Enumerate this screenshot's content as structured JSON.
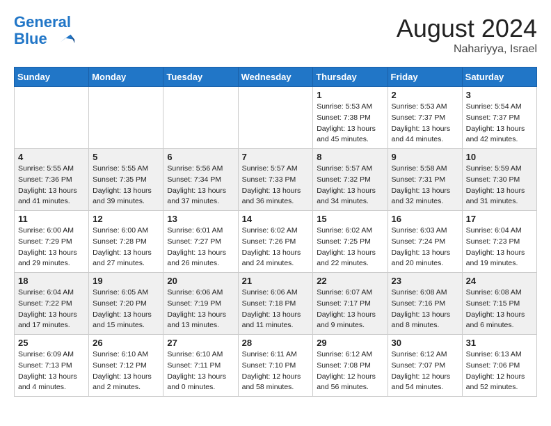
{
  "header": {
    "logo_line1": "General",
    "logo_line2": "Blue",
    "month": "August 2024",
    "location": "Nahariyya, Israel"
  },
  "weekdays": [
    "Sunday",
    "Monday",
    "Tuesday",
    "Wednesday",
    "Thursday",
    "Friday",
    "Saturday"
  ],
  "weeks": [
    [
      {
        "day": "",
        "detail": ""
      },
      {
        "day": "",
        "detail": ""
      },
      {
        "day": "",
        "detail": ""
      },
      {
        "day": "",
        "detail": ""
      },
      {
        "day": "1",
        "detail": "Sunrise: 5:53 AM\nSunset: 7:38 PM\nDaylight: 13 hours\nand 45 minutes."
      },
      {
        "day": "2",
        "detail": "Sunrise: 5:53 AM\nSunset: 7:37 PM\nDaylight: 13 hours\nand 44 minutes."
      },
      {
        "day": "3",
        "detail": "Sunrise: 5:54 AM\nSunset: 7:37 PM\nDaylight: 13 hours\nand 42 minutes."
      }
    ],
    [
      {
        "day": "4",
        "detail": "Sunrise: 5:55 AM\nSunset: 7:36 PM\nDaylight: 13 hours\nand 41 minutes."
      },
      {
        "day": "5",
        "detail": "Sunrise: 5:55 AM\nSunset: 7:35 PM\nDaylight: 13 hours\nand 39 minutes."
      },
      {
        "day": "6",
        "detail": "Sunrise: 5:56 AM\nSunset: 7:34 PM\nDaylight: 13 hours\nand 37 minutes."
      },
      {
        "day": "7",
        "detail": "Sunrise: 5:57 AM\nSunset: 7:33 PM\nDaylight: 13 hours\nand 36 minutes."
      },
      {
        "day": "8",
        "detail": "Sunrise: 5:57 AM\nSunset: 7:32 PM\nDaylight: 13 hours\nand 34 minutes."
      },
      {
        "day": "9",
        "detail": "Sunrise: 5:58 AM\nSunset: 7:31 PM\nDaylight: 13 hours\nand 32 minutes."
      },
      {
        "day": "10",
        "detail": "Sunrise: 5:59 AM\nSunset: 7:30 PM\nDaylight: 13 hours\nand 31 minutes."
      }
    ],
    [
      {
        "day": "11",
        "detail": "Sunrise: 6:00 AM\nSunset: 7:29 PM\nDaylight: 13 hours\nand 29 minutes."
      },
      {
        "day": "12",
        "detail": "Sunrise: 6:00 AM\nSunset: 7:28 PM\nDaylight: 13 hours\nand 27 minutes."
      },
      {
        "day": "13",
        "detail": "Sunrise: 6:01 AM\nSunset: 7:27 PM\nDaylight: 13 hours\nand 26 minutes."
      },
      {
        "day": "14",
        "detail": "Sunrise: 6:02 AM\nSunset: 7:26 PM\nDaylight: 13 hours\nand 24 minutes."
      },
      {
        "day": "15",
        "detail": "Sunrise: 6:02 AM\nSunset: 7:25 PM\nDaylight: 13 hours\nand 22 minutes."
      },
      {
        "day": "16",
        "detail": "Sunrise: 6:03 AM\nSunset: 7:24 PM\nDaylight: 13 hours\nand 20 minutes."
      },
      {
        "day": "17",
        "detail": "Sunrise: 6:04 AM\nSunset: 7:23 PM\nDaylight: 13 hours\nand 19 minutes."
      }
    ],
    [
      {
        "day": "18",
        "detail": "Sunrise: 6:04 AM\nSunset: 7:22 PM\nDaylight: 13 hours\nand 17 minutes."
      },
      {
        "day": "19",
        "detail": "Sunrise: 6:05 AM\nSunset: 7:20 PM\nDaylight: 13 hours\nand 15 minutes."
      },
      {
        "day": "20",
        "detail": "Sunrise: 6:06 AM\nSunset: 7:19 PM\nDaylight: 13 hours\nand 13 minutes."
      },
      {
        "day": "21",
        "detail": "Sunrise: 6:06 AM\nSunset: 7:18 PM\nDaylight: 13 hours\nand 11 minutes."
      },
      {
        "day": "22",
        "detail": "Sunrise: 6:07 AM\nSunset: 7:17 PM\nDaylight: 13 hours\nand 9 minutes."
      },
      {
        "day": "23",
        "detail": "Sunrise: 6:08 AM\nSunset: 7:16 PM\nDaylight: 13 hours\nand 8 minutes."
      },
      {
        "day": "24",
        "detail": "Sunrise: 6:08 AM\nSunset: 7:15 PM\nDaylight: 13 hours\nand 6 minutes."
      }
    ],
    [
      {
        "day": "25",
        "detail": "Sunrise: 6:09 AM\nSunset: 7:13 PM\nDaylight: 13 hours\nand 4 minutes."
      },
      {
        "day": "26",
        "detail": "Sunrise: 6:10 AM\nSunset: 7:12 PM\nDaylight: 13 hours\nand 2 minutes."
      },
      {
        "day": "27",
        "detail": "Sunrise: 6:10 AM\nSunset: 7:11 PM\nDaylight: 13 hours\nand 0 minutes."
      },
      {
        "day": "28",
        "detail": "Sunrise: 6:11 AM\nSunset: 7:10 PM\nDaylight: 12 hours\nand 58 minutes."
      },
      {
        "day": "29",
        "detail": "Sunrise: 6:12 AM\nSunset: 7:08 PM\nDaylight: 12 hours\nand 56 minutes."
      },
      {
        "day": "30",
        "detail": "Sunrise: 6:12 AM\nSunset: 7:07 PM\nDaylight: 12 hours\nand 54 minutes."
      },
      {
        "day": "31",
        "detail": "Sunrise: 6:13 AM\nSunset: 7:06 PM\nDaylight: 12 hours\nand 52 minutes."
      }
    ]
  ]
}
